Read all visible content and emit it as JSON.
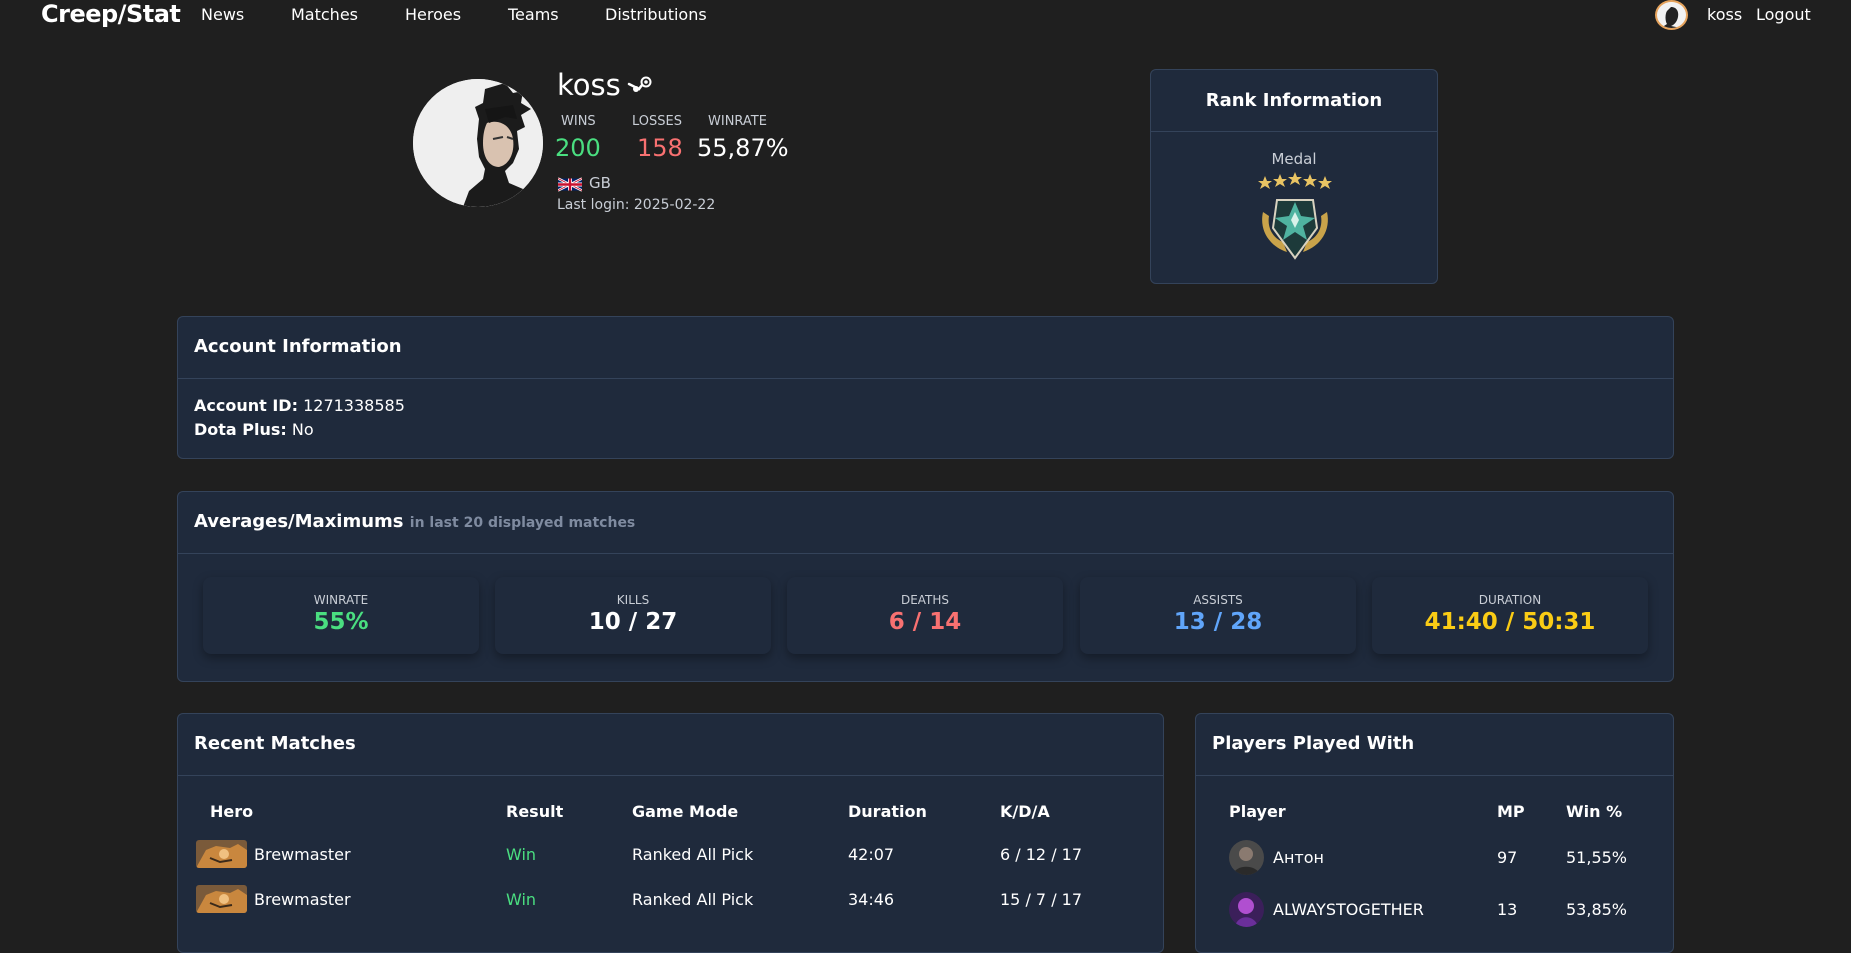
{
  "nav": {
    "brand": "Creep/Stat",
    "links": [
      "News",
      "Matches",
      "Heroes",
      "Teams",
      "Distributions"
    ],
    "user": "koss",
    "logout": "Logout"
  },
  "profile": {
    "name": "koss",
    "wins_label": "WINS",
    "losses_label": "LOSSES",
    "winrate_label": "WINRATE",
    "wins": "200",
    "losses": "158",
    "winrate": "55,87%",
    "country": "GB",
    "last_login": "Last login: 2025-02-22"
  },
  "rank": {
    "title": "Rank Information",
    "medal_label": "Medal"
  },
  "account": {
    "title": "Account Information",
    "id_label": "Account ID:",
    "id_value": "1271338585",
    "plus_label": "Dota Plus:",
    "plus_value": "No"
  },
  "averages": {
    "title": "Averages/Maximums",
    "subtitle": "in last 20 displayed matches",
    "tiles": [
      {
        "label": "WINRATE",
        "value": "55%",
        "color": "#4ade80"
      },
      {
        "label": "KILLS",
        "value": "10 / 27",
        "color": "#ffffff"
      },
      {
        "label": "DEATHS",
        "value": "6 / 14",
        "color": "#f87171"
      },
      {
        "label": "ASSISTS",
        "value": "13 / 28",
        "color": "#60a5fa"
      },
      {
        "label": "DURATION",
        "value": "41:40 / 50:31",
        "color": "#facc15"
      }
    ]
  },
  "recent_matches": {
    "title": "Recent Matches",
    "headers": [
      "Hero",
      "Result",
      "Game Mode",
      "Duration",
      "K/D/A"
    ],
    "rows": [
      {
        "hero": "Brewmaster",
        "result": "Win",
        "mode": "Ranked All Pick",
        "duration": "42:07",
        "kda": "6 / 12 / 17"
      },
      {
        "hero": "Brewmaster",
        "result": "Win",
        "mode": "Ranked All Pick",
        "duration": "34:46",
        "kda": "15 / 7 / 17"
      }
    ]
  },
  "players": {
    "title": "Players Played With",
    "headers": [
      "Player",
      "MP",
      "Win %"
    ],
    "rows": [
      {
        "name": "Антон",
        "mp": "97",
        "win": "51,55%"
      },
      {
        "name": "ALWAYSTOGETHER",
        "mp": "13",
        "win": "53,85%"
      }
    ]
  },
  "colors": {
    "win": "#4ade80",
    "loss": "#f87171",
    "card_bg": "#1f2a3c",
    "page_bg": "#1f1f1f"
  },
  "icons": [
    "steam-icon",
    "uk-flag-icon",
    "medal-icon"
  ]
}
